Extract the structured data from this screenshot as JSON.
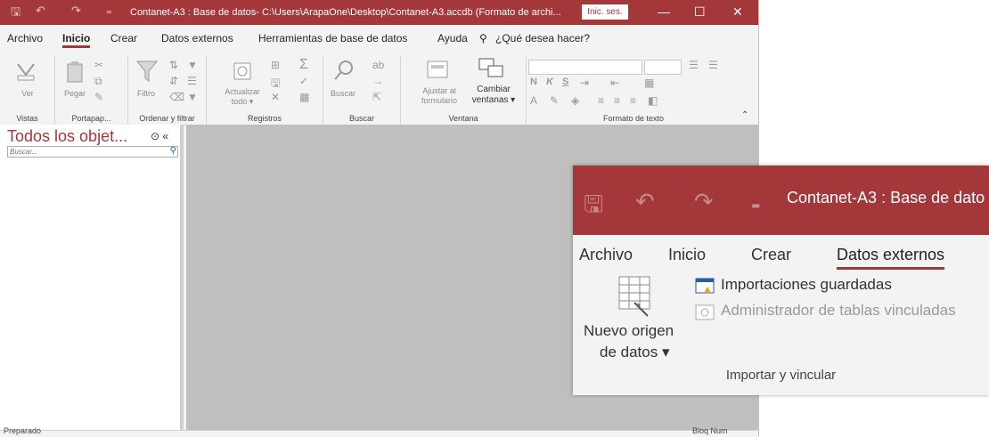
{
  "window": {
    "title": "Contanet-A3 : Base de datos- C:\\Users\\ArapaOne\\Desktop\\Contanet-A3.accdb (Formato de archi...",
    "signin": "Inic. ses.",
    "controls": {
      "minimize": "—",
      "maximize": "☐",
      "close": "✕"
    },
    "qat": {
      "save": "🖫",
      "undo": "↶",
      "redo": "↷",
      "customize": "₌"
    },
    "accent": "#a4373a"
  },
  "tabs": [
    "Archivo",
    "Inicio",
    "Crear",
    "Datos externos",
    "Herramientas de base de datos",
    "Ayuda"
  ],
  "active_tab": "Inicio",
  "tell_me": "¿Qué desea hacer?",
  "ribbon": {
    "vistas": {
      "label": "Vistas",
      "ver": "Ver"
    },
    "portapapeles": {
      "label": "Portapap...",
      "pegar": "Pegar"
    },
    "ordenar": {
      "label": "Ordenar y filtrar",
      "filtro": "Filtro"
    },
    "registros": {
      "label": "Registros",
      "actualizar": "Actualizar",
      "todo": "todo ▾"
    },
    "buscar": {
      "label": "Buscar",
      "buscar": "Buscar"
    },
    "ventana": {
      "label": "Ventana",
      "ajustar1": "Ajustar al",
      "ajustar2": "formulario",
      "cambiar1": "Cambiar",
      "cambiar2": "ventanas ▾"
    },
    "formato": {
      "label": "Formato de texto",
      "n": "N",
      "k": "K",
      "s": "S"
    }
  },
  "nav_pane": {
    "title": "Todos los objet...",
    "search_placeholder": "Buscar..."
  },
  "status": {
    "left": "Preparado",
    "right": "Bloq Num"
  },
  "zoom": {
    "title": "Contanet-A3 : Base de dato",
    "tabs": [
      "Archivo",
      "Inicio",
      "Crear",
      "Datos externos"
    ],
    "active_tab": "Datos externos",
    "nuevo_origen_1": "Nuevo origen",
    "nuevo_origen_2": "de datos ▾",
    "importaciones": "Importaciones guardadas",
    "administrador": "Administrador de tablas vinculadas",
    "group_label": "Importar y vincular"
  }
}
